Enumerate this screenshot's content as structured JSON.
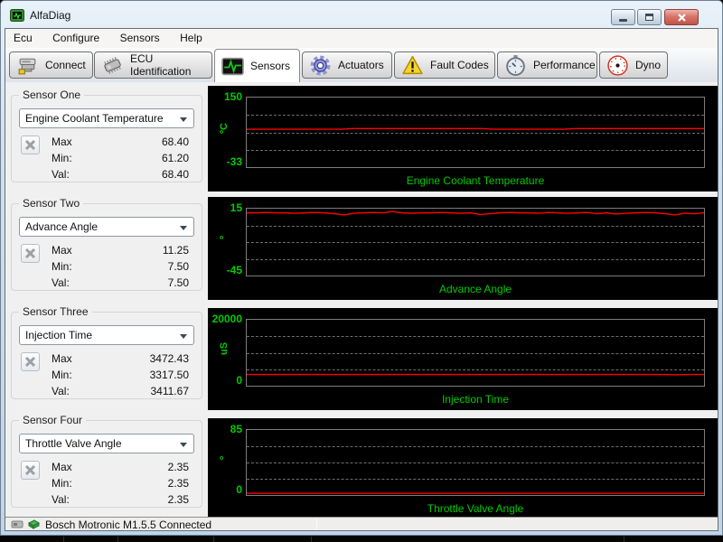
{
  "window": {
    "title": "AlfaDiag"
  },
  "menu": {
    "items": [
      "Ecu",
      "Configure",
      "Sensors",
      "Help"
    ]
  },
  "tabs": [
    {
      "label": "Connect",
      "icon": "connect-icon",
      "active": false
    },
    {
      "label": "ECU Identification",
      "icon": "chip-icon",
      "active": false
    },
    {
      "label": "Sensors",
      "icon": "oscilloscope-icon",
      "active": true
    },
    {
      "label": "Actuators",
      "icon": "gear-icon",
      "active": false
    },
    {
      "label": "Fault Codes",
      "icon": "warning-icon",
      "active": false
    },
    {
      "label": "Performance",
      "icon": "stopwatch-icon",
      "active": false
    },
    {
      "label": "Dyno",
      "icon": "gauge-icon",
      "active": false
    }
  ],
  "row_labels": {
    "max": "Max",
    "min": "Min:",
    "val": "Val:"
  },
  "sensors": [
    {
      "group": "Sensor One",
      "selected": "Engine Coolant Temperature",
      "max": "68.40",
      "min": "61.20",
      "val": "68.40"
    },
    {
      "group": "Sensor Two",
      "selected": "Advance Angle",
      "max": "11.25",
      "min": "7.50",
      "val": "7.50"
    },
    {
      "group": "Sensor Three",
      "selected": "Injection Time",
      "max": "3472.43",
      "min": "3317.50",
      "val": "3411.67"
    },
    {
      "group": "Sensor Four",
      "selected": "Throttle Valve Angle",
      "max": "2.35",
      "min": "2.35",
      "val": "2.35"
    }
  ],
  "chart_data": [
    {
      "type": "line",
      "title": "Engine Coolant Temperature",
      "ylabel": "ºC",
      "ylim": [
        -33,
        150
      ],
      "ymax_label": "150",
      "ymin_label": "-33",
      "grid": "horizontal dashed at 25/50/75%",
      "legend": "none",
      "values": [
        66.6,
        66.6,
        66.6,
        66.6,
        66.6,
        66.6,
        66.6,
        66.6,
        66.6,
        68.4,
        68.4,
        68.4,
        68.4,
        68.4,
        68.4,
        68.4,
        68.4,
        68.4,
        68.4,
        68.4,
        68.4,
        66.6,
        66.6,
        66.6,
        66.6,
        66.6,
        66.6,
        66.6,
        68.4,
        68.4,
        68.4,
        68.4,
        68.4,
        68.4,
        68.4,
        68.4,
        68.4,
        68.4,
        68.4,
        68.4
      ]
    },
    {
      "type": "line",
      "title": "Advance Angle",
      "ylabel": "º",
      "ylim": [
        -45,
        15
      ],
      "ymax_label": "15",
      "ymin_label": "-45",
      "grid": "horizontal dashed at 25/50/75%",
      "legend": "none",
      "values": [
        11.25,
        11.25,
        11.6,
        11.25,
        11.25,
        10.9,
        11.25,
        11.6,
        11.25,
        10.5,
        9.4,
        10.9,
        11.25,
        11.6,
        11.25,
        12.4,
        11.25,
        10.9,
        11.25,
        11.25,
        11.6,
        11.25,
        10.9,
        11.25,
        9.8,
        10.5,
        11.25,
        11.6,
        11.25,
        11.25,
        10.9,
        11.6,
        11.25,
        10.9,
        11.25,
        11.6,
        10.5,
        11.25,
        10.2,
        10.9,
        11.25,
        11.6,
        11.25,
        10.5,
        9.4,
        10.9,
        10.5,
        11.25
      ]
    },
    {
      "type": "line",
      "title": "Injection Time",
      "ylabel": "uS",
      "ylim": [
        0,
        20000
      ],
      "ymax_label": "20000",
      "ymin_label": "0",
      "grid": "horizontal dashed at 25/50/75%",
      "legend": "none",
      "values": [
        3411,
        3411,
        3411,
        3411,
        3411,
        3411,
        3411,
        3411,
        3411,
        3411,
        3411,
        3411,
        3411,
        3411,
        3411,
        3411,
        3411,
        3411,
        3411,
        3411,
        3411,
        3411,
        3411,
        3411,
        3411,
        3411,
        3411,
        3411,
        3411,
        3411,
        3411,
        3411,
        3411,
        3411,
        3411,
        3411,
        3411,
        3411,
        3411,
        3411,
        3411,
        3411,
        3411,
        3411,
        3317,
        3380,
        3411,
        3411
      ]
    },
    {
      "type": "line",
      "title": "Throttle Valve Angle",
      "ylabel": "º",
      "ylim": [
        0,
        85
      ],
      "ymax_label": "85",
      "ymin_label": "0",
      "grid": "horizontal dashed at 25/50/75%",
      "legend": "none",
      "values": [
        2.35,
        2.35,
        2.35,
        2.35,
        2.35,
        2.35,
        2.35,
        2.35,
        2.35,
        2.35,
        2.35,
        2.35,
        2.35,
        2.35,
        2.35,
        2.35,
        2.35,
        2.35,
        2.35,
        2.35,
        2.35,
        2.35,
        2.35,
        2.35,
        2.35,
        2.35,
        2.35,
        2.35,
        2.35,
        2.35,
        2.35,
        2.35,
        2.35,
        2.35,
        2.35,
        2.35,
        2.35,
        2.35,
        2.35,
        2.35
      ]
    }
  ],
  "statusbar": {
    "text": "Bosch Motronic M1.5.5 Connected"
  },
  "colors": {
    "trace": "#ff0000",
    "chart_label": "#00cc00",
    "chart_bg": "#000000",
    "client_bg": "#f0f0f0",
    "close_button": "#bd5448",
    "fault_icon": "#f6d32d",
    "actuator_icon": "#8d96d8"
  }
}
